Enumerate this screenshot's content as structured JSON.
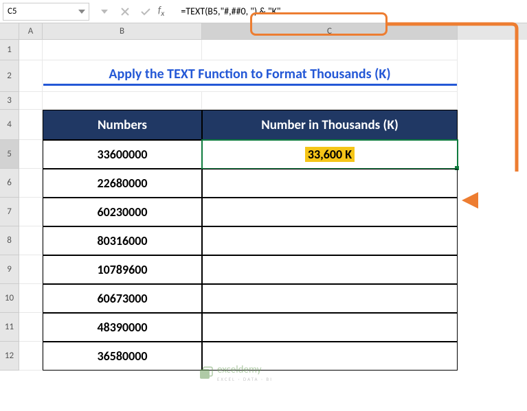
{
  "name_box": "C5",
  "formula": "=TEXT(B5,\"#,##0, \") & \"K\"",
  "columns": [
    "A",
    "B",
    "C"
  ],
  "rows": [
    "1",
    "2",
    "3",
    "4",
    "5",
    "6",
    "7",
    "8",
    "9",
    "10",
    "11",
    "12"
  ],
  "title": "Apply the TEXT Function to Format Thousands (K)",
  "table": {
    "headers": {
      "b": "Numbers",
      "c": "Number in Thousands (K)"
    },
    "rows": [
      {
        "b": "33600000",
        "c": "33,600 K"
      },
      {
        "b": "22680000",
        "c": ""
      },
      {
        "b": "60230000",
        "c": ""
      },
      {
        "b": "80316000",
        "c": ""
      },
      {
        "b": "10789600",
        "c": ""
      },
      {
        "b": "60673000",
        "c": ""
      },
      {
        "b": "48390000",
        "c": ""
      },
      {
        "b": "36580000",
        "c": ""
      }
    ]
  },
  "watermark": {
    "brand": "exceldemy",
    "tagline": "EXCEL · DATA · BI"
  }
}
